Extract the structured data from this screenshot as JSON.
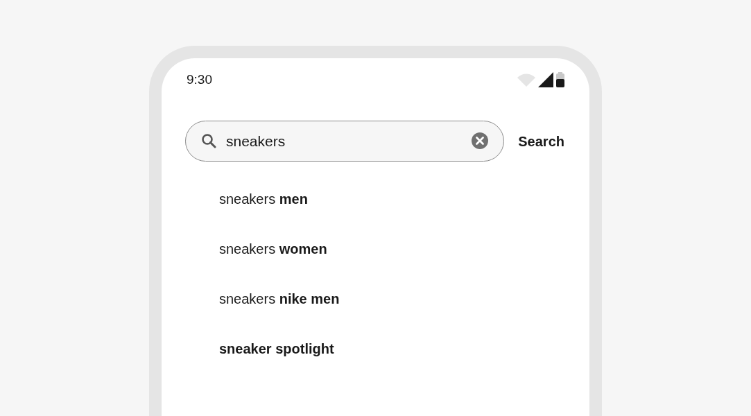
{
  "status_bar": {
    "time": "9:30"
  },
  "search": {
    "value": "sneakers",
    "button": "Search"
  },
  "suggestions": [
    {
      "text": "sneakers **men**",
      "bold": false
    },
    {
      "text": "sneakers **women**",
      "bold": false
    },
    {
      "text": "sneakers **nike men**",
      "bold": false
    },
    {
      "text": "sneaker spotlight",
      "bold": true
    }
  ]
}
